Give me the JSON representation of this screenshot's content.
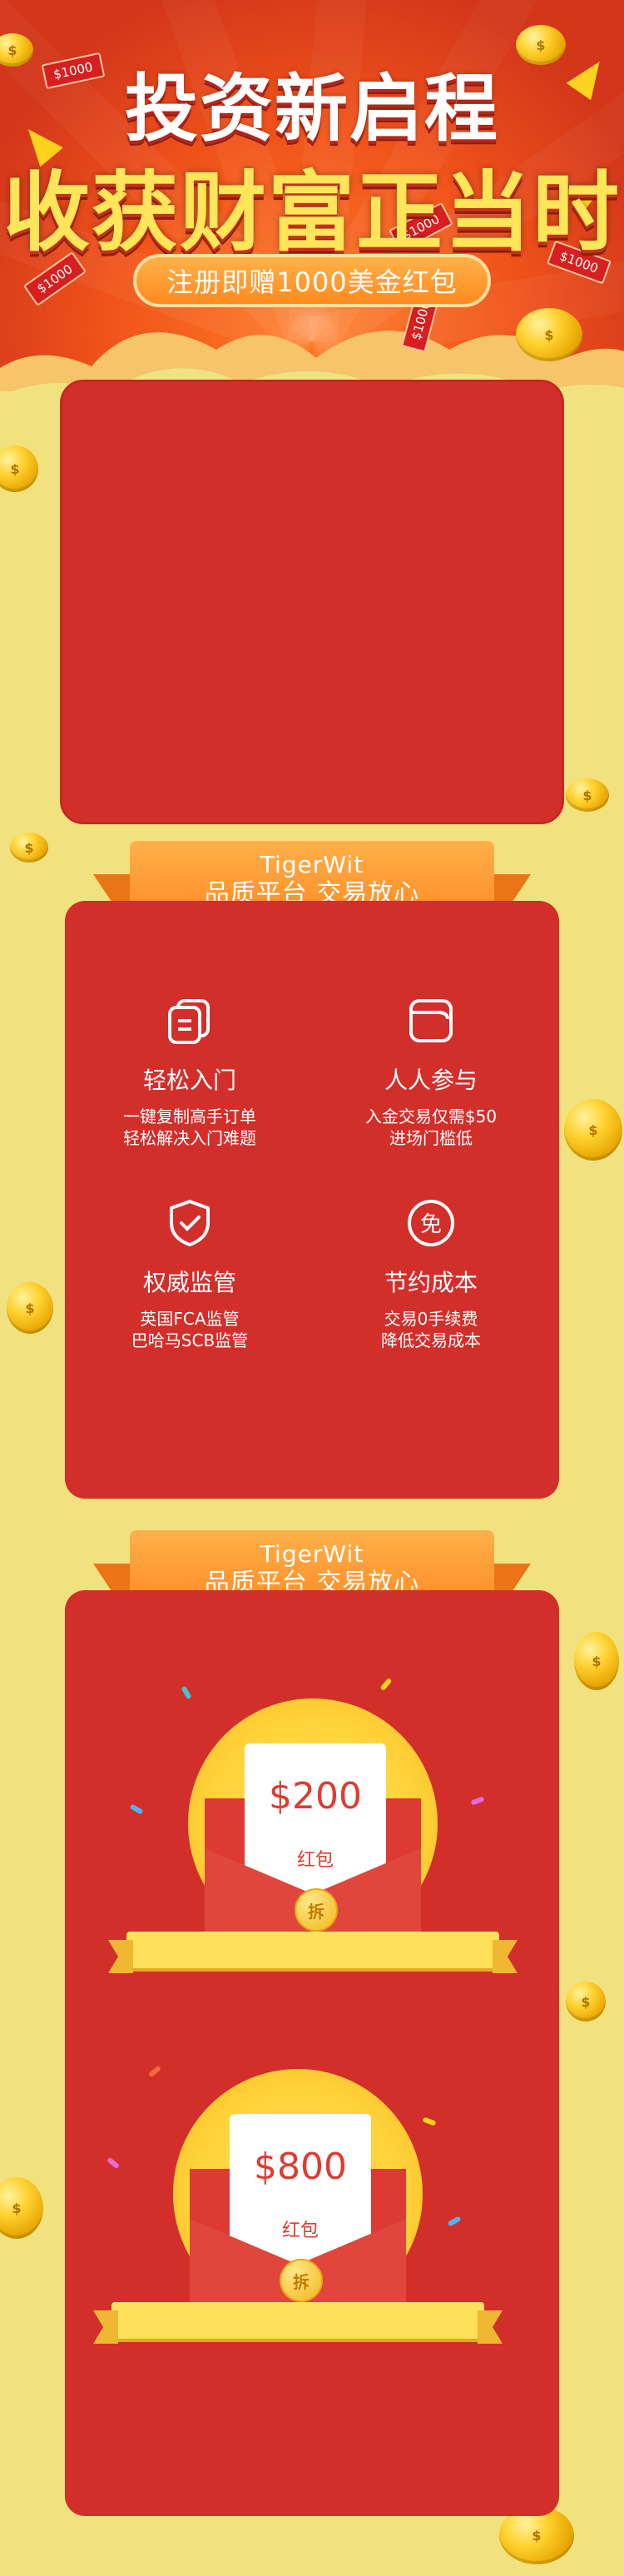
{
  "hero": {
    "title_line1": "投资新启程",
    "title_line2": "收获财富正当时",
    "subtitle": "注册即赠1000美金红包",
    "bill_labels": [
      "$1000",
      "$1000",
      "$1000",
      "$1000",
      "$1000"
    ]
  },
  "section1": {
    "ribbon_line1": "TigerWit",
    "ribbon_line2": "品质平台 交易放心",
    "features": [
      {
        "icon": "copy-icon",
        "title": "轻松入门",
        "desc_line1": "一键复制高手订单",
        "desc_line2": "轻松解决入门难题"
      },
      {
        "icon": "wallet-icon",
        "title": "人人参与",
        "desc_line1": "入金交易仅需$50",
        "desc_line2": "进场门槛低"
      },
      {
        "icon": "shield-icon",
        "title": "权威监管",
        "desc_line1": "英国FCA监管",
        "desc_line2": "巴哈马SCB监管"
      },
      {
        "icon": "free-icon",
        "title": "节约成本",
        "desc_line1": "交易0手续费",
        "desc_line2": "降低交易成本"
      }
    ]
  },
  "section2": {
    "ribbon_line1": "TigerWit",
    "ribbon_line2": "品质平台 交易放心",
    "packets": [
      {
        "amount": "$200",
        "label": "红包",
        "seal": "拆"
      },
      {
        "amount": "$800",
        "label": "红包",
        "seal": "拆"
      }
    ]
  },
  "colors": {
    "background": "#f1e27f",
    "panel_red": "#d22f2b",
    "ribbon_orange": "#ff8a23",
    "gold": "#ffd230"
  }
}
